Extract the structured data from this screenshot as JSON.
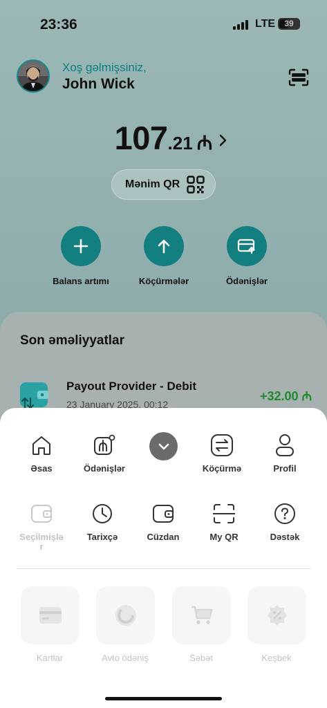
{
  "status_bar": {
    "time": "23:36",
    "network": "LTE",
    "battery": "39"
  },
  "header": {
    "greeting": "Xoş gəlmişsiniz,",
    "user_name": "John Wick"
  },
  "balance": {
    "integer": "107",
    "decimal": ".21",
    "currency": "₼"
  },
  "qr_button": {
    "label": "Mənim QR"
  },
  "actions": [
    {
      "label": "Balans artımı",
      "icon": "plus-icon"
    },
    {
      "label": "Köçürmələr",
      "icon": "arrow-up-icon"
    },
    {
      "label": "Ödənişlər",
      "icon": "payment-card-icon"
    }
  ],
  "recent": {
    "title": "Son əməliyyatlar",
    "transactions": [
      {
        "title": "Payout Provider - Debit",
        "date": "23 January 2025, 00:12",
        "amount": "+32.00 ₼",
        "amount_color": "#1f8c2f"
      }
    ]
  },
  "menu": {
    "row1": [
      {
        "label": "Əsas",
        "icon": "home-icon"
      },
      {
        "label": "Ödənişlər",
        "icon": "payments-icon"
      },
      {
        "label": "",
        "icon": "chevron-down-icon"
      },
      {
        "label": "Köçürmə",
        "icon": "transfer-icon"
      },
      {
        "label": "Profil",
        "icon": "profile-icon"
      }
    ],
    "row2": [
      {
        "label": "Seçilmişlə\nr",
        "icon": "favorites-icon"
      },
      {
        "label": "Tarixçə",
        "icon": "clock-icon"
      },
      {
        "label": "Cüzdan",
        "icon": "wallet-icon"
      },
      {
        "label": "My QR",
        "icon": "qr-scan-icon"
      },
      {
        "label": "Dəstək",
        "icon": "help-icon"
      }
    ],
    "cards": [
      {
        "label": "Kartlar",
        "icon": "card-icon"
      },
      {
        "label": "Avto ödəniş",
        "icon": "auto-pay-icon"
      },
      {
        "label": "Səbət",
        "icon": "cart-icon"
      },
      {
        "label": "Keşbek",
        "icon": "cashback-icon"
      }
    ]
  },
  "colors": {
    "accent": "#137f80",
    "positive": "#1f8c2f",
    "greeting": "#0d7e7f"
  }
}
